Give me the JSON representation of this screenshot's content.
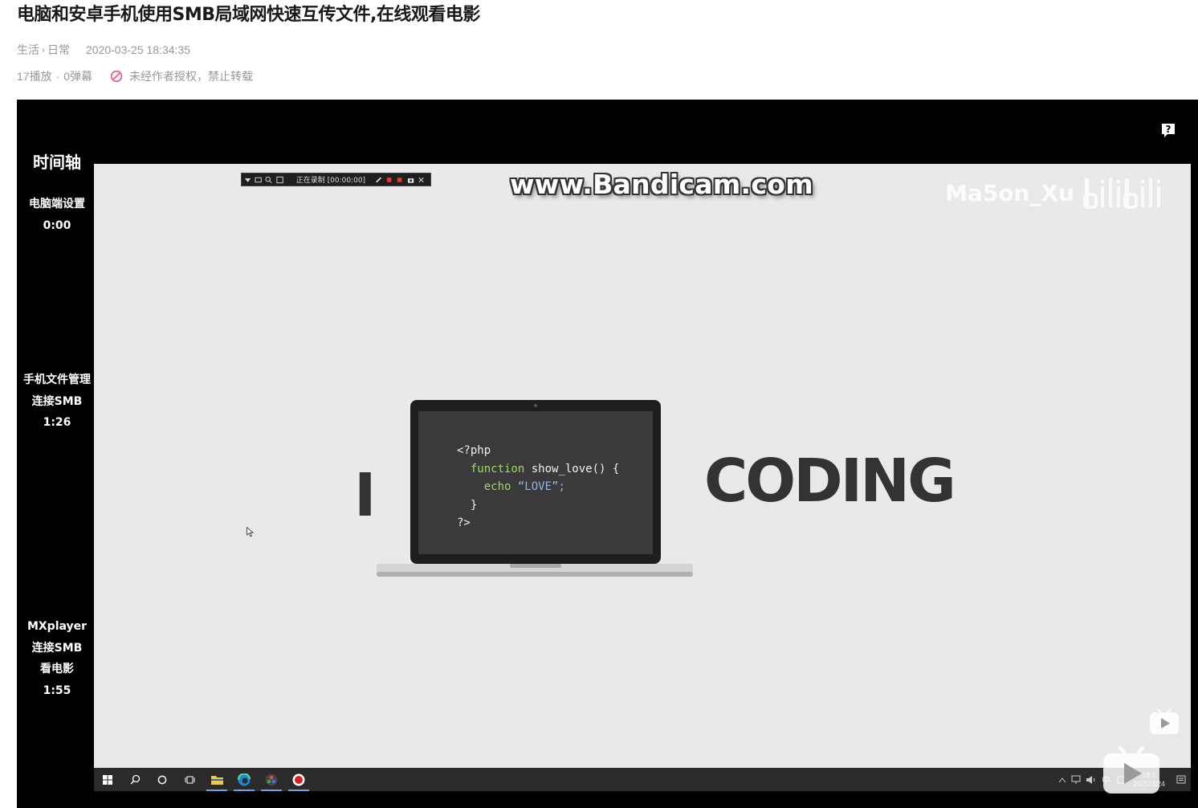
{
  "page": {
    "title": "电脑和安卓手机使用SMB局域网快速互传文件,在线观看电影",
    "breadcrumb": [
      "生活",
      "日常"
    ],
    "publish_time": "2020-03-25 18:34:35",
    "plays": "17播放",
    "dot": "·",
    "danmaku": "0弹幕",
    "copyright_notice": "未经作者授权，禁止转载",
    "colors": {
      "meta_text": "#9499a0",
      "ban_icon": "#f25d8e"
    }
  },
  "player": {
    "help_icon": "question-mark-icon",
    "timeline": {
      "title": "时间轴",
      "entries": [
        {
          "lines": [
            "电脑端设置",
            "0:00"
          ]
        },
        {
          "lines": [
            "手机文件管理",
            "连接SMB",
            "1:26"
          ]
        },
        {
          "lines": [
            "MXplayer",
            "连接SMB",
            "看电影",
            "1:55"
          ]
        }
      ]
    },
    "video": {
      "watermark_site": "www.Bandicam.com",
      "uploader_watermark": "Ma5on_Xu",
      "recorder_status": "正在录制 [00:00:00]",
      "big_letter": "I",
      "big_word": "CODING",
      "code_lines": [
        "<?php",
        "function",
        "show_love() {",
        "echo",
        "“LOVE”;",
        "}",
        "?>"
      ],
      "taskbar_icons": [
        "windows-start-icon",
        "search-icon",
        "cortana-icon",
        "task-view-icon",
        "file-explorer-icon",
        "edge-icon",
        "davinci-icon",
        "bandicam-icon"
      ],
      "tray_clock": {
        "time": "18:5",
        "date": "2020/3/24"
      },
      "tray_ime": "中"
    }
  }
}
